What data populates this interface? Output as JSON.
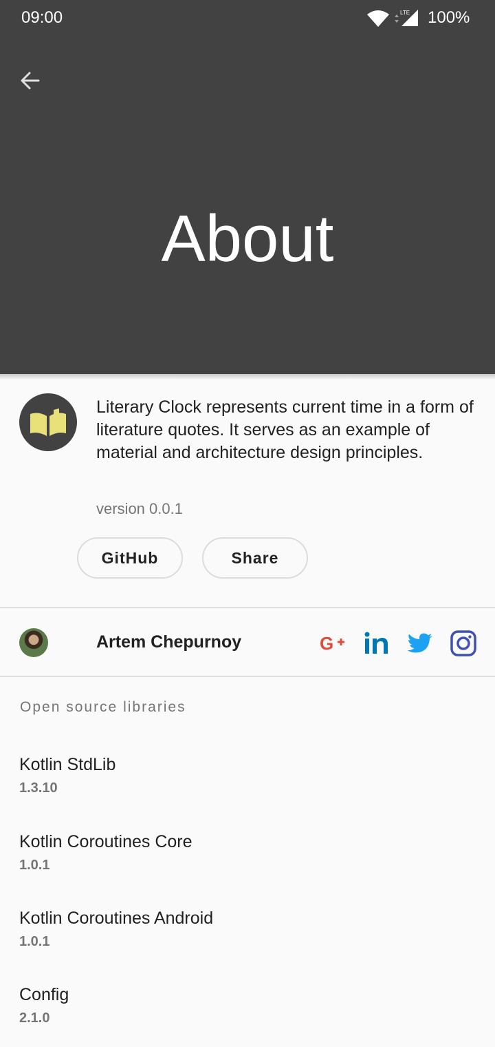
{
  "status_bar": {
    "time": "09:00",
    "battery": "100%",
    "network": "LTE"
  },
  "header": {
    "title": "About"
  },
  "app": {
    "description": "Literary Clock represents current time in a form of literature quotes. It serves as an example of material and architecture design principles.",
    "version": "version 0.0.1",
    "buttons": {
      "github": "GitHub",
      "share": "Share"
    },
    "logo_color": "#e8e17a"
  },
  "author": {
    "name": "Artem Chepurnoy",
    "social": [
      "google-plus",
      "linkedin",
      "twitter",
      "instagram"
    ]
  },
  "libraries": {
    "title": "Open source libraries",
    "items": [
      {
        "name": "Kotlin StdLib",
        "version": "1.3.10"
      },
      {
        "name": "Kotlin Coroutines Core",
        "version": "1.0.1"
      },
      {
        "name": "Kotlin Coroutines Android",
        "version": "1.0.1"
      },
      {
        "name": "Config",
        "version": "2.1.0"
      }
    ]
  },
  "colors": {
    "header": "#424242",
    "google_plus": "#dd4b39",
    "linkedin": "#0077b5",
    "twitter": "#1da1f2",
    "instagram": "#3f51b5"
  }
}
